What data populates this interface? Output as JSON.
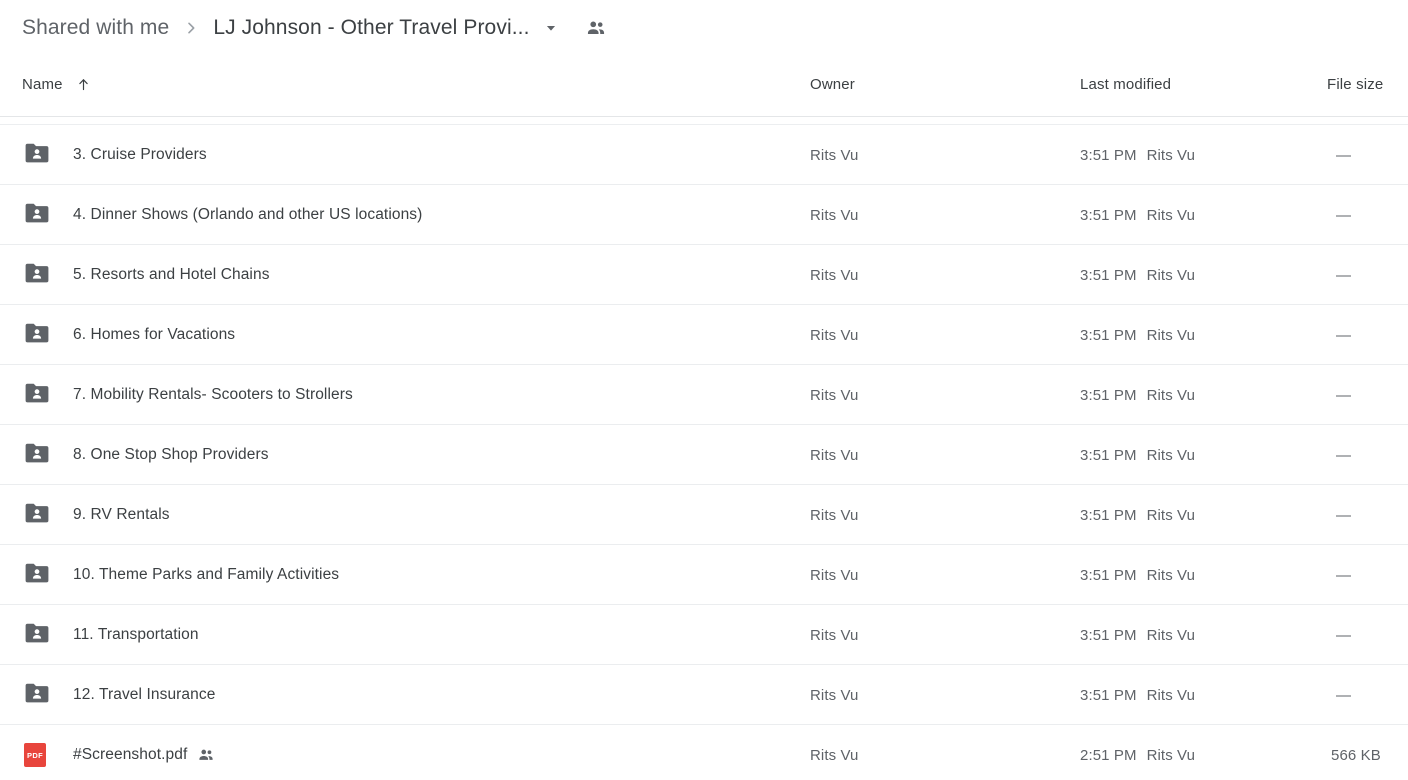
{
  "breadcrumb": {
    "root_label": "Shared with me",
    "separator_icon": "chevron-right-icon",
    "current_label": "LJ Johnson - Other Travel Provi...",
    "caret_icon": "chevron-down-icon",
    "people_icon": "people-icon"
  },
  "columns": {
    "name": "Name",
    "sort_icon": "arrow-up-icon",
    "owner": "Owner",
    "last_modified": "Last modified",
    "file_size": "File size"
  },
  "rows": [
    {
      "icon": "shared-folder-icon",
      "name": "3. Cruise Providers",
      "owner": "Rits Vu",
      "modified_time": "3:51 PM",
      "modified_by": "Rits Vu",
      "size": "—",
      "shared": false
    },
    {
      "icon": "shared-folder-icon",
      "name": "4. Dinner Shows (Orlando and other US locations)",
      "owner": "Rits Vu",
      "modified_time": "3:51 PM",
      "modified_by": "Rits Vu",
      "size": "—",
      "shared": false
    },
    {
      "icon": "shared-folder-icon",
      "name": "5. Resorts and Hotel Chains",
      "owner": "Rits Vu",
      "modified_time": "3:51 PM",
      "modified_by": "Rits Vu",
      "size": "—",
      "shared": false
    },
    {
      "icon": "shared-folder-icon",
      "name": "6. Homes for Vacations",
      "owner": "Rits Vu",
      "modified_time": "3:51 PM",
      "modified_by": "Rits Vu",
      "size": "—",
      "shared": false
    },
    {
      "icon": "shared-folder-icon",
      "name": "7. Mobility Rentals- Scooters to Strollers",
      "owner": "Rits Vu",
      "modified_time": "3:51 PM",
      "modified_by": "Rits Vu",
      "size": "—",
      "shared": false
    },
    {
      "icon": "shared-folder-icon",
      "name": "8. One Stop Shop Providers",
      "owner": "Rits Vu",
      "modified_time": "3:51 PM",
      "modified_by": "Rits Vu",
      "size": "—",
      "shared": false
    },
    {
      "icon": "shared-folder-icon",
      "name": "9. RV Rentals",
      "owner": "Rits Vu",
      "modified_time": "3:51 PM",
      "modified_by": "Rits Vu",
      "size": "—",
      "shared": false
    },
    {
      "icon": "shared-folder-icon",
      "name": "10. Theme Parks and Family Activities",
      "owner": "Rits Vu",
      "modified_time": "3:51 PM",
      "modified_by": "Rits Vu",
      "size": "—",
      "shared": false
    },
    {
      "icon": "shared-folder-icon",
      "name": "11. Transportation",
      "owner": "Rits Vu",
      "modified_time": "3:51 PM",
      "modified_by": "Rits Vu",
      "size": "—",
      "shared": false
    },
    {
      "icon": "shared-folder-icon",
      "name": "12. Travel Insurance",
      "owner": "Rits Vu",
      "modified_time": "3:51 PM",
      "modified_by": "Rits Vu",
      "size": "—",
      "shared": false
    },
    {
      "icon": "pdf-file-icon",
      "icon_label": "PDF",
      "name": "#Screenshot.pdf",
      "owner": "Rits Vu",
      "modified_time": "2:51 PM",
      "modified_by": "Rits Vu",
      "size": "566 KB",
      "shared": true,
      "shared_icon": "people-icon"
    }
  ],
  "colors": {
    "pdf_red": "#e8453c",
    "folder_gray": "#5f6368",
    "text_primary": "#3c4043",
    "text_secondary": "#5f6368",
    "divider": "#ebedef"
  }
}
